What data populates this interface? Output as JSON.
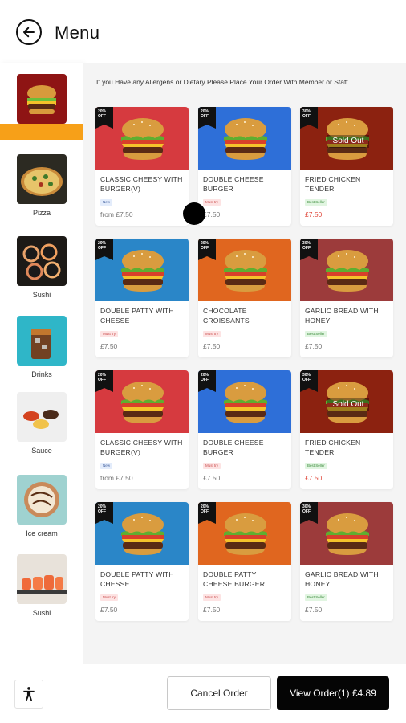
{
  "header": {
    "title": "Menu"
  },
  "sidebar": {
    "items": [
      {
        "label": "",
        "image": "burger"
      },
      {
        "label": "Pizza",
        "image": "pizza"
      },
      {
        "label": "Sushi",
        "image": "sushi"
      },
      {
        "label": "Drinks",
        "image": "drinks"
      },
      {
        "label": "Sauce",
        "image": "sauce"
      },
      {
        "label": "Ice cream",
        "image": "ice-cream"
      },
      {
        "label": "Sushi",
        "image": "sushi-rolls"
      }
    ],
    "active_color": "#f7a018"
  },
  "notice": "If you Have any Allergens or Dietary Please Place Your Order With Member or Staff",
  "products": [
    {
      "name": "CLASSIC CHEESY WITH BURGER(V)",
      "badge": "20% OFF",
      "tag": "New",
      "tag_color": "blue",
      "price": "from £7.50",
      "bg": "#d63a3f",
      "sold_out": ""
    },
    {
      "name": "DOUBLE CHEESE BURGER",
      "badge": "20% OFF",
      "tag": "Must try",
      "tag_color": "pink",
      "price": "£7.50",
      "bg": "#2e6fd8",
      "sold_out": ""
    },
    {
      "name": "FRIED CHICKEN TENDER",
      "badge": "30% OFF",
      "tag": "Best Seller",
      "tag_color": "green",
      "price": "£7.50",
      "bg": "#8c2210",
      "sold_out": "Sold Out"
    },
    {
      "name": "DOUBLE PATTY WITH CHESSE",
      "badge": "20% OFF",
      "tag": "Must try",
      "tag_color": "pink",
      "price": "£7.50",
      "bg": "#2a86c8",
      "sold_out": ""
    },
    {
      "name": "CHOCOLATE CROISSANTS",
      "badge": "20% OFF",
      "tag": "Must try",
      "tag_color": "pink",
      "price": "£7.50",
      "bg": "#e0661f",
      "sold_out": ""
    },
    {
      "name": "GARLIC BREAD WITH HONEY",
      "badge": "30% OFF",
      "tag": "Best Seller",
      "tag_color": "green",
      "price": "£7.50",
      "bg": "#9c3b3b",
      "sold_out": ""
    },
    {
      "name": "CLASSIC CHEESY WITH BURGER(V)",
      "badge": "20% OFF",
      "tag": "New",
      "tag_color": "blue",
      "price": "from £7.50",
      "bg": "#d63a3f",
      "sold_out": ""
    },
    {
      "name": "DOUBLE CHEESE BURGER",
      "badge": "20% OFF",
      "tag": "Must try",
      "tag_color": "pink",
      "price": "£7.50",
      "bg": "#2e6fd8",
      "sold_out": ""
    },
    {
      "name": "FRIED CHICKEN TENDER",
      "badge": "30% OFF",
      "tag": "Best Seller",
      "tag_color": "green",
      "price": "£7.50",
      "bg": "#8c2210",
      "sold_out": "Sold Out"
    },
    {
      "name": "DOUBLE PATTY WITH CHESSE",
      "badge": "20% OFF",
      "tag": "Must try",
      "tag_color": "pink",
      "price": "£7.50",
      "bg": "#2a86c8",
      "sold_out": ""
    },
    {
      "name": "DOUBLE PATTY CHEESE BURGER",
      "badge": "20% OFF",
      "tag": "Must try",
      "tag_color": "pink",
      "price": "£7.50",
      "bg": "#e0661f",
      "sold_out": ""
    },
    {
      "name": "GARLIC BREAD WITH HONEY",
      "badge": "30% OFF",
      "tag": "Best Seller",
      "tag_color": "green",
      "price": "£7.50",
      "bg": "#9c3b3b",
      "sold_out": ""
    }
  ],
  "footer": {
    "cancel_label": "Cancel Order",
    "view_label": "View Order(1) £4.89"
  }
}
